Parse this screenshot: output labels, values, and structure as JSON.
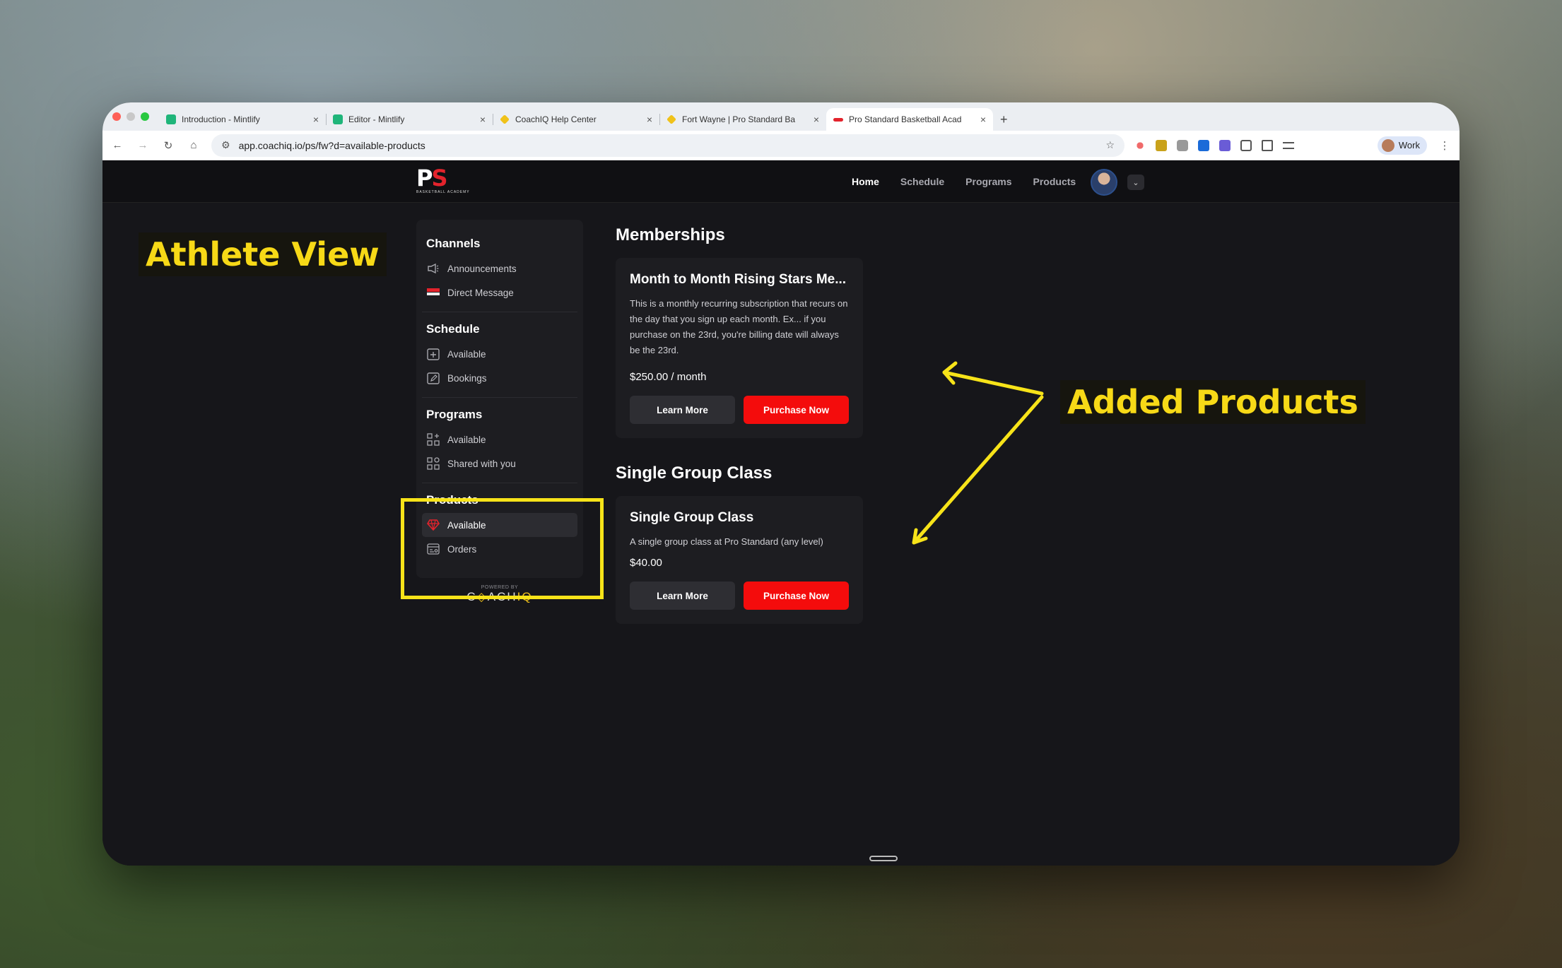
{
  "browser": {
    "tabs": [
      {
        "title": "Introduction - Mintlify",
        "favicon_color": "#1fb57a",
        "active": false
      },
      {
        "title": "Editor - Mintlify",
        "favicon_color": "#1fb57a",
        "active": false
      },
      {
        "title": "CoachIQ Help Center",
        "favicon_color": "#f0c21a",
        "active": false
      },
      {
        "title": "Fort Wayne | Pro Standard Ba",
        "favicon_color": "#f0c21a",
        "active": false
      },
      {
        "title": "Pro Standard Basketball Acad",
        "favicon_color": "#e3232c",
        "active": true
      }
    ],
    "new_tab": "+",
    "url": "app.coachiq.io/ps/fw?d=available-products",
    "profile_name": "Work"
  },
  "app": {
    "logo": {
      "mark_p": "P",
      "mark_s": "S",
      "subtitle": "BASKETBALL ACADEMY"
    },
    "nav": [
      "Home",
      "Schedule",
      "Programs",
      "Products"
    ],
    "active_nav": "Home"
  },
  "sidebar": {
    "channels": {
      "title": "Channels",
      "items": [
        "Announcements",
        "Direct Message"
      ]
    },
    "schedule": {
      "title": "Schedule",
      "items": [
        "Available",
        "Bookings"
      ]
    },
    "programs": {
      "title": "Programs",
      "items": [
        "Available",
        "Shared with you"
      ]
    },
    "products": {
      "title": "Products",
      "items": [
        "Available",
        "Orders"
      ],
      "active": "Available"
    },
    "powered_by": "POWERED BY",
    "brand": {
      "pre": "C",
      "mid": "◇",
      "post": "ACH",
      "accent": "IQ"
    }
  },
  "main": {
    "memberships": {
      "heading": "Memberships",
      "card": {
        "title": "Month to Month Rising Stars Me...",
        "description": "This is a monthly recurring subscription that recurs on the day that you sign up each month. Ex... if you purchase on the 23rd, you're billing date will always be the 23rd.",
        "price": "$250.00 / month",
        "learn_more": "Learn More",
        "purchase": "Purchase Now"
      }
    },
    "single_group": {
      "heading": "Single Group Class",
      "card": {
        "title": "Single Group Class",
        "description": "A single group class at Pro Standard (any level)",
        "price": "$40.00",
        "learn_more": "Learn More",
        "purchase": "Purchase Now"
      }
    }
  },
  "annotations": {
    "athlete_view": "Athlete View",
    "added_products": "Added Products",
    "color": "#f7e319"
  }
}
